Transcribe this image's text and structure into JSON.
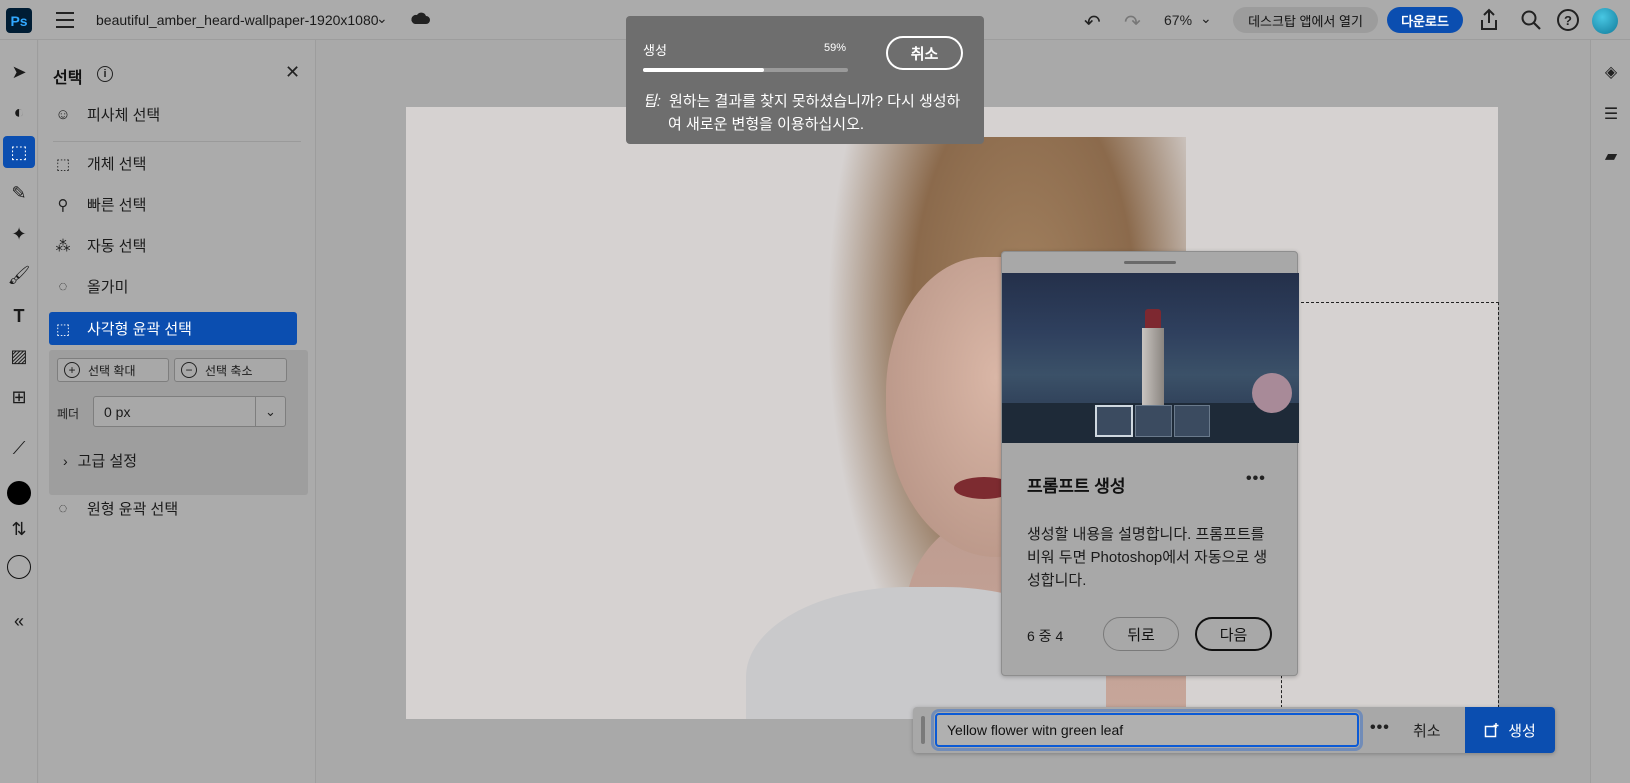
{
  "topbar": {
    "logo": "Ps",
    "document_title": "beautiful_amber_heard-wallpaper-1920x1080",
    "zoom": "67%",
    "open_desktop_label": "데스크탑 앱에서 열기",
    "download_label": "다운로드"
  },
  "left_tools": {
    "active_tool": "rectangle-marquee",
    "items": [
      "select-arrow",
      "adjust",
      "marquee",
      "healing",
      "generative",
      "brush",
      "type",
      "image-add",
      "add-shape",
      "eyedropper",
      "foreground-color",
      "swap-colors",
      "background-color",
      "collapse"
    ]
  },
  "selection_panel": {
    "title": "선택",
    "items": [
      {
        "label": "피사체 선택",
        "icon": "subject-icon"
      },
      {
        "label": "개체 선택",
        "icon": "object-select-icon"
      },
      {
        "label": "빠른 선택",
        "icon": "quick-select-icon"
      },
      {
        "label": "자동 선택",
        "icon": "magic-wand-icon"
      },
      {
        "label": "올가미",
        "icon": "lasso-icon"
      },
      {
        "label": "사각형 윤곽 선택",
        "icon": "rect-marquee-icon"
      },
      {
        "label": "원형 윤곽 선택",
        "icon": "ellipse-marquee-icon"
      }
    ],
    "expand_label": "선택 확대",
    "contract_label": "선택 축소",
    "feather_label": "페더",
    "feather_value": "0 px",
    "advanced_label": "고급 설정"
  },
  "toast": {
    "label": "생성",
    "percent": "59%",
    "progress": 0.59,
    "cancel_label": "취소",
    "tip_prefix": "팁:",
    "tip_text": "원하는 결과를 찾지 못하셨습니까? 다시 생성하여 새로운 변형을 이용하십시오."
  },
  "prompt_card": {
    "title": "프롬프트 생성",
    "body": "생성할 내용을 설명합니다. 프롬프트를 비워 두면 Photoshop에서 자동으로 생성합니다.",
    "step": "6 중 4",
    "back_label": "뒤로",
    "next_label": "다음"
  },
  "prompt_bar": {
    "input_value": "Yellow flower witn green leaf",
    "cancel_label": "취소",
    "generate_label": "생성"
  },
  "colors": {
    "accent": "#0b4eb0",
    "toast_bg": "#6e6e6e"
  }
}
